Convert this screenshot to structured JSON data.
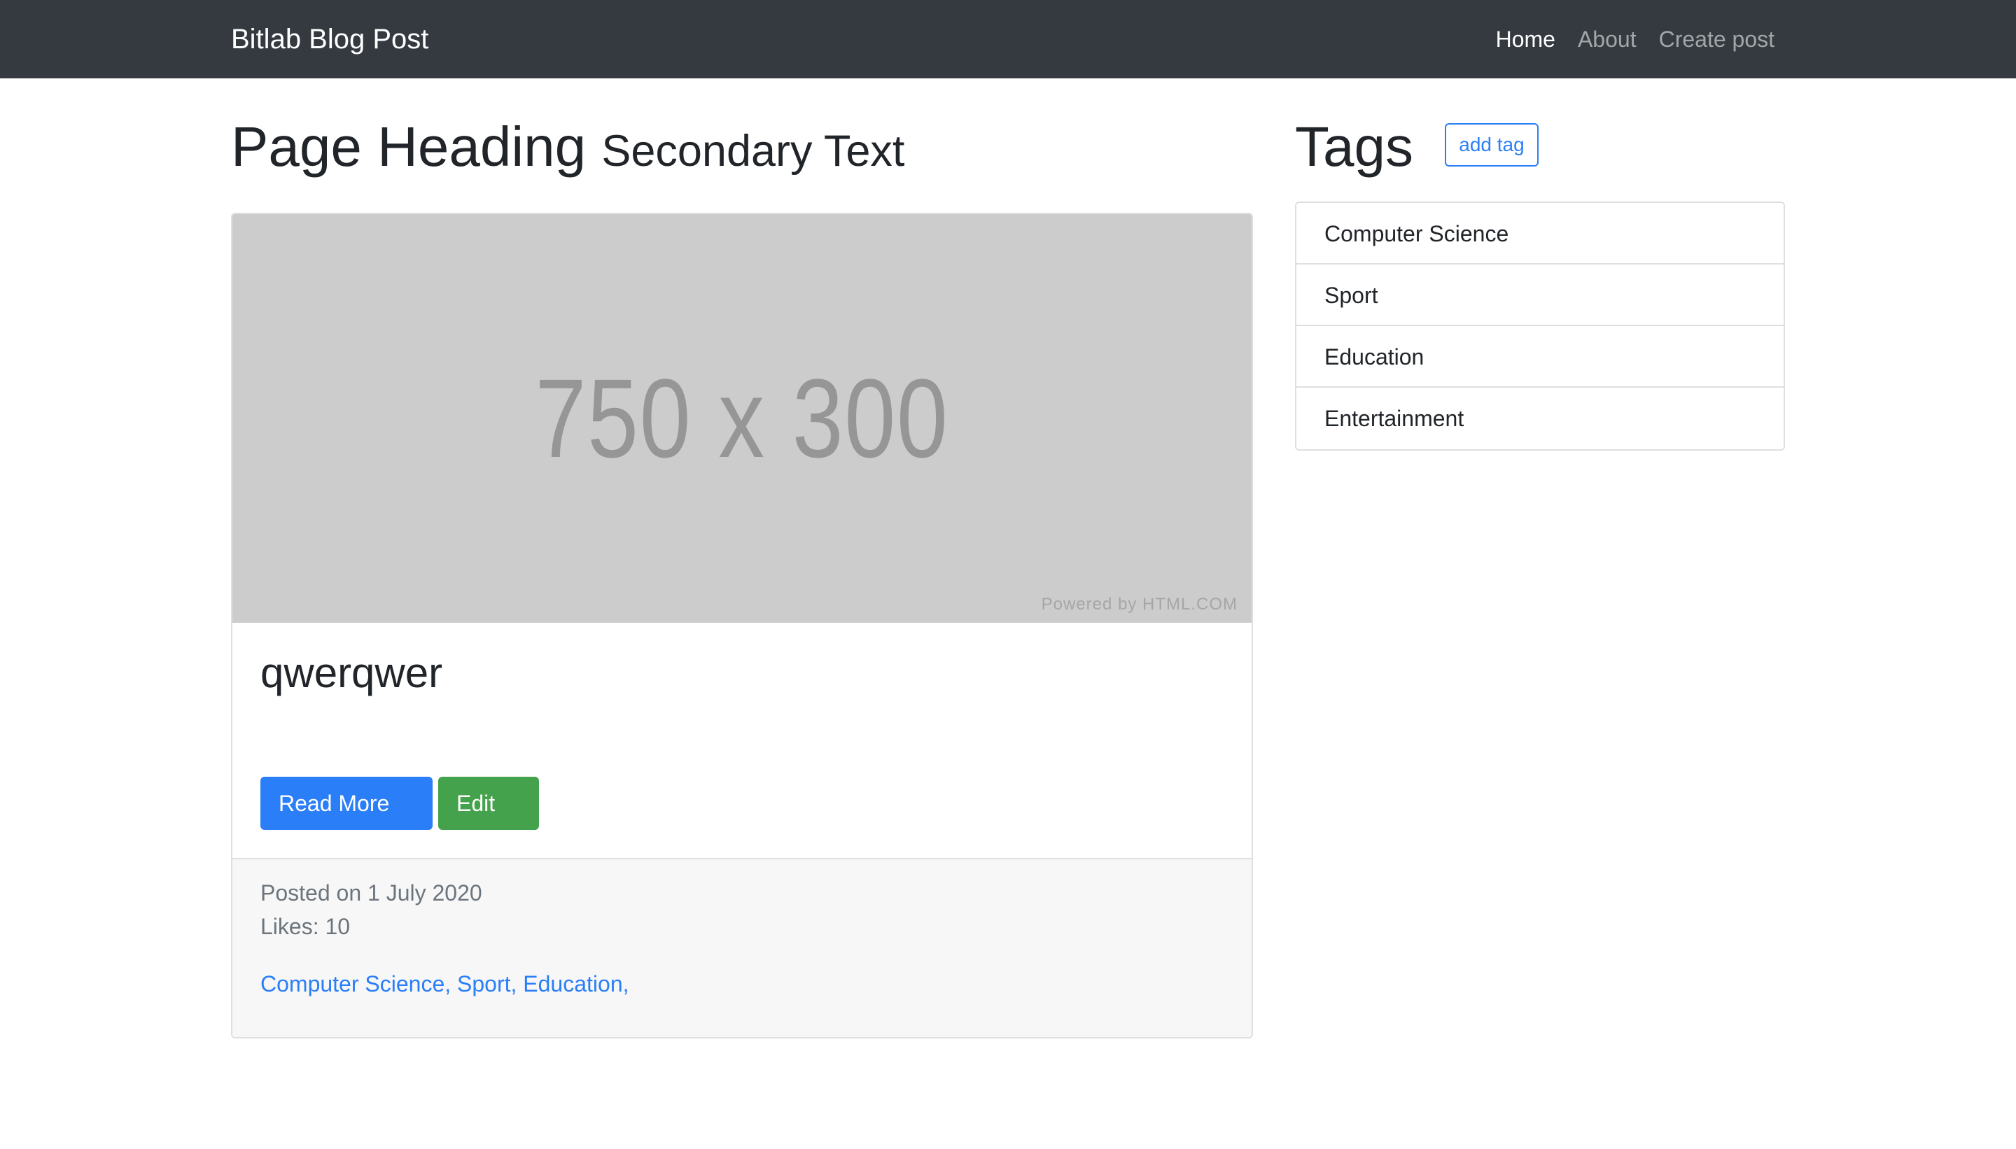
{
  "navbar": {
    "brand": "Bitlab Blog Post",
    "links": [
      {
        "label": "Home",
        "active": true
      },
      {
        "label": "About",
        "active": false
      },
      {
        "label": "Create post",
        "active": false
      }
    ]
  },
  "main": {
    "heading": "Page Heading",
    "subheading": "Secondary Text",
    "post": {
      "image_text": "750 x 300",
      "image_credit": "Powered by HTML.COM",
      "title": "qwerqwer",
      "text": "qwerqwer",
      "read_more_label": "Read More →",
      "edit_label": "Edit →",
      "posted_on": "Posted on 1 July 2020",
      "likes": "Likes: 10",
      "tags": [
        "Computer Science",
        "Sport",
        "Education"
      ],
      "tag_separator": ", ",
      "tag_trailing": ","
    }
  },
  "sidebar": {
    "heading": "Tags",
    "add_tag_label": "add tag",
    "items": [
      {
        "label": "Computer Science"
      },
      {
        "label": "Sport"
      },
      {
        "label": "Education"
      },
      {
        "label": "Entertainment"
      }
    ]
  },
  "colors": {
    "navbar_bg": "#343a40",
    "primary": "#2a7ef8",
    "success": "#43a24b",
    "placeholder_bg": "#cccccc",
    "footer_bg": "#f7f7f7"
  }
}
